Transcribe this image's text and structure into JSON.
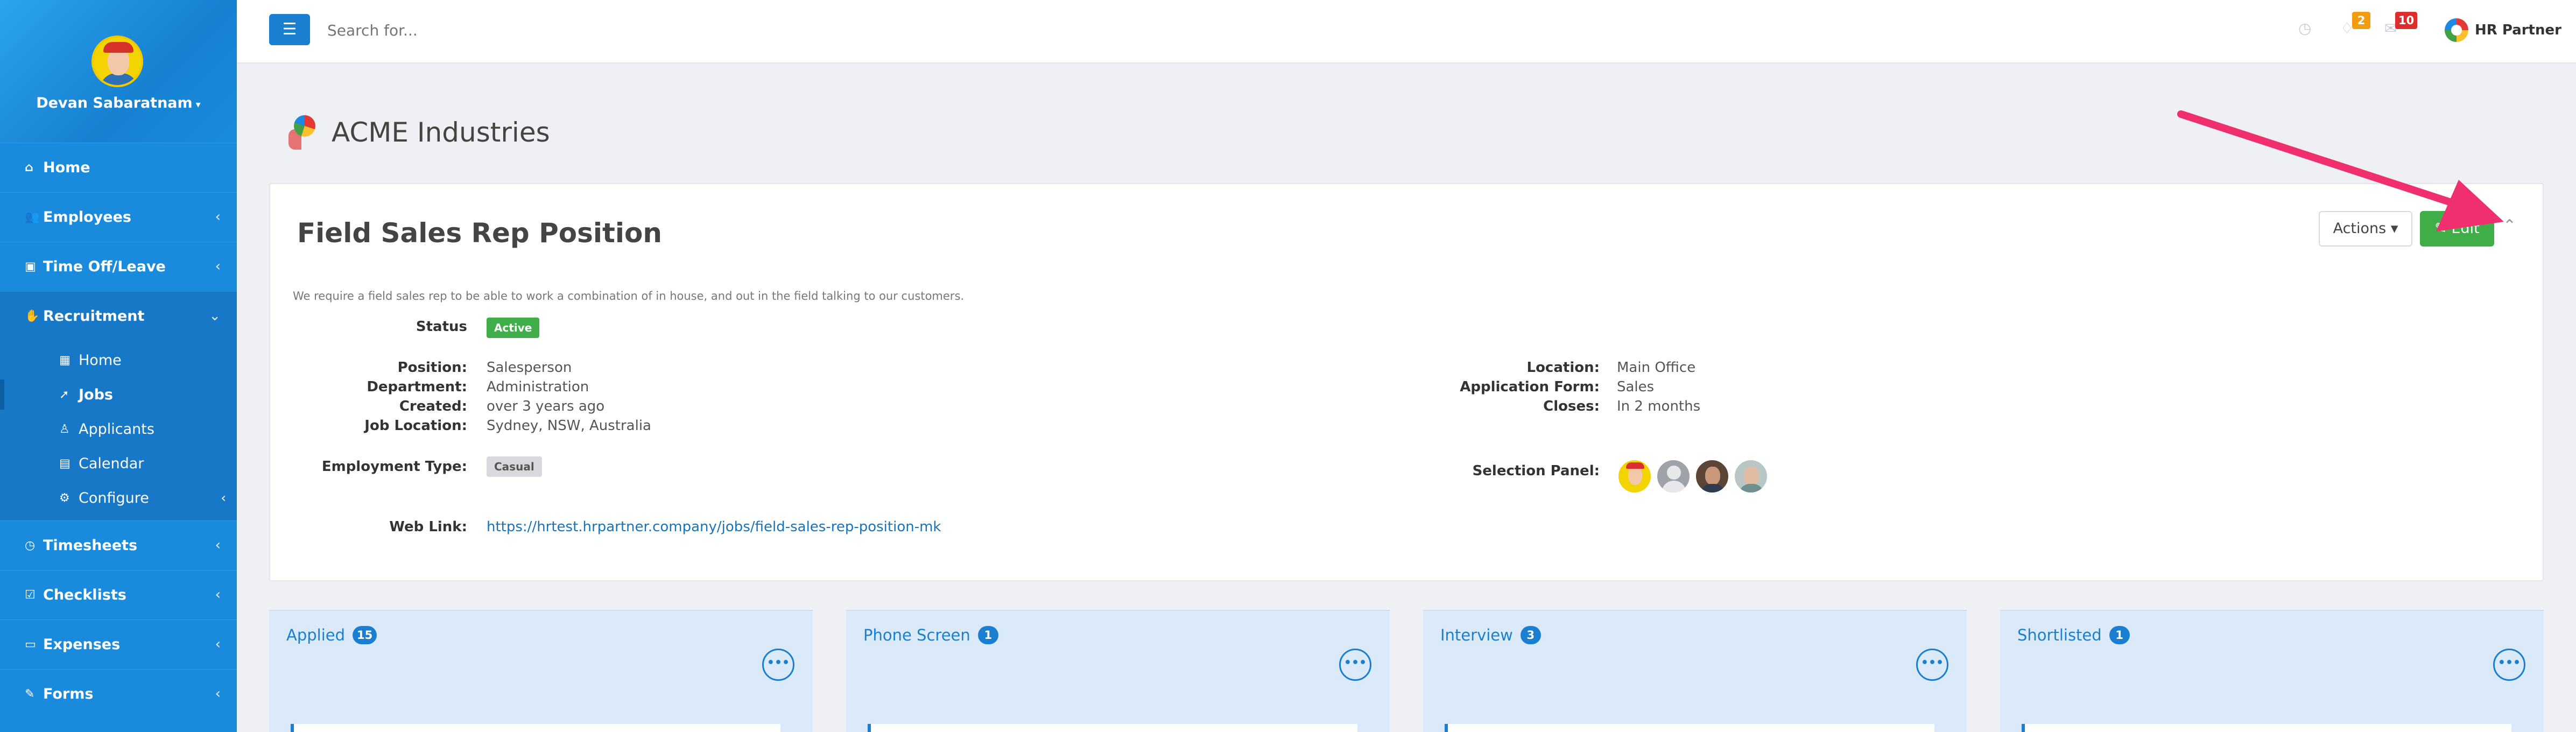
{
  "user": {
    "name": "Devan Sabaratnam"
  },
  "sidebar": {
    "items": [
      {
        "label": "Home",
        "icon": "home-icon"
      },
      {
        "label": "Employees",
        "icon": "users-icon"
      },
      {
        "label": "Time Off/Leave",
        "icon": "suitcase-icon"
      },
      {
        "label": "Recruitment",
        "icon": "handshake-icon"
      }
    ],
    "recruitment_sub": [
      {
        "label": "Home",
        "icon": "grid-icon"
      },
      {
        "label": "Jobs",
        "icon": "rocket-icon"
      },
      {
        "label": "Applicants",
        "icon": "person-icon"
      },
      {
        "label": "Calendar",
        "icon": "calendar-icon"
      },
      {
        "label": "Configure",
        "icon": "gear-icon"
      }
    ],
    "items_after": [
      {
        "label": "Timesheets",
        "icon": "clock-icon"
      },
      {
        "label": "Checklists",
        "icon": "check-square-icon"
      },
      {
        "label": "Expenses",
        "icon": "money-icon"
      },
      {
        "label": "Forms",
        "icon": "edit-icon"
      }
    ]
  },
  "topbar": {
    "search_placeholder": "Search for...",
    "notifications_count": "2",
    "messages_count": "10",
    "brand": "HR Partner"
  },
  "company": {
    "name": "ACME Industries"
  },
  "job": {
    "title": "Field Sales Rep Position",
    "actions_label": "Actions",
    "edit_label": "Edit",
    "description": "We require a field sales rep to be able to work a combination of in house, and out in the field talking to our customers.",
    "status_label": "Status",
    "status_value": "Active",
    "position_label": "Position:",
    "position": "Salesperson",
    "department_label": "Department:",
    "department": "Administration",
    "created_label": "Created:",
    "created": "over 3 years ago",
    "job_location_label": "Job Location:",
    "job_location": "Sydney, NSW, Australia",
    "location_label": "Location:",
    "location": "Main Office",
    "app_form_label": "Application Form:",
    "app_form": "Sales",
    "closes_label": "Closes:",
    "closes": "In 2 months",
    "employment_type_label": "Employment Type:",
    "employment_type": "Casual",
    "selection_panel_label": "Selection Panel:",
    "web_link_label": "Web Link:",
    "web_link": "https://hrtest.hrpartner.company/jobs/field-sales-rep-position-mk"
  },
  "pipeline": [
    {
      "name": "Applied",
      "count": "15"
    },
    {
      "name": "Phone Screen",
      "count": "1"
    },
    {
      "name": "Interview",
      "count": "3"
    },
    {
      "name": "Shortlisted",
      "count": "1"
    }
  ],
  "colors": {
    "sidebar": "#1a8bdc",
    "primary": "#1a7fd0",
    "success": "#3fae49",
    "annotation_arrow": "#f0306e",
    "badge_orange": "#f39c12",
    "badge_red": "#dd2c2c"
  }
}
